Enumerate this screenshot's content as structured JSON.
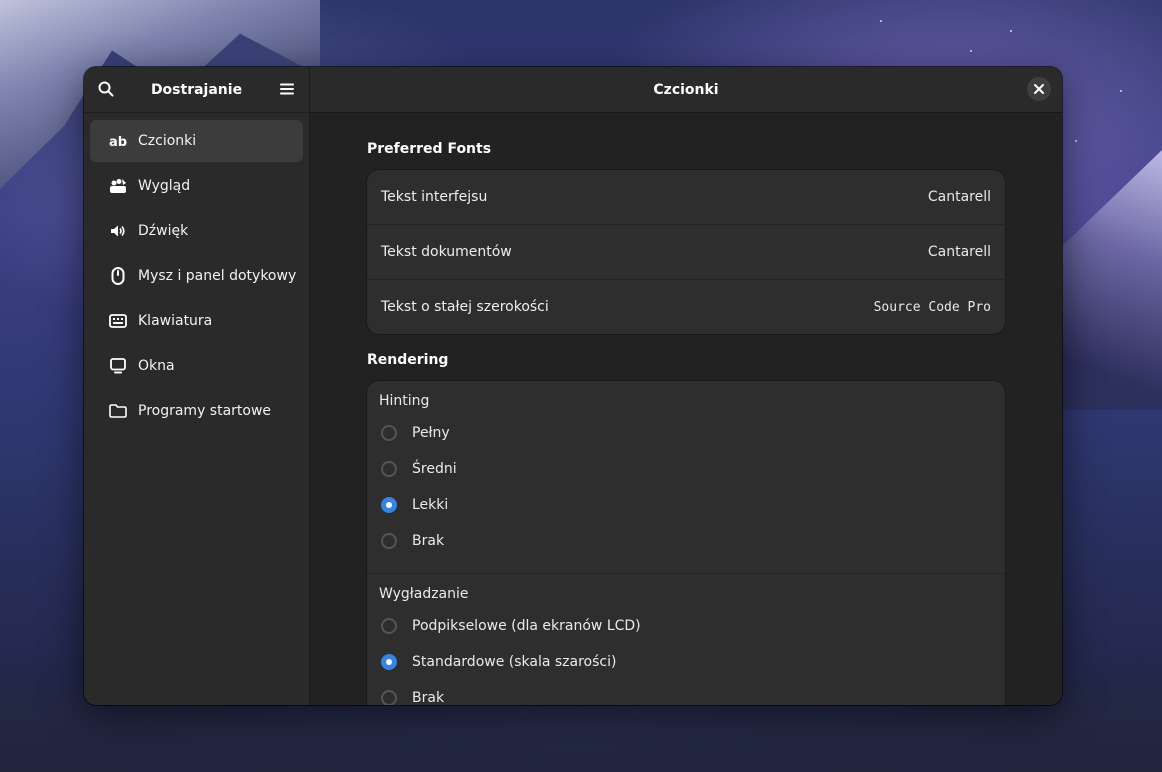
{
  "sidebar": {
    "title": "Dostrajanie",
    "search_icon": "search-icon",
    "menu_icon": "hamburger-menu-icon",
    "items": [
      {
        "label": "Czcionki",
        "icon": "fonts-ab-icon",
        "active": true
      },
      {
        "label": "Wygląd",
        "icon": "appearance-icon",
        "active": false
      },
      {
        "label": "Dźwięk",
        "icon": "speaker-icon",
        "active": false
      },
      {
        "label": "Mysz i panel dotykowy",
        "icon": "mouse-icon",
        "active": false
      },
      {
        "label": "Klawiatura",
        "icon": "keyboard-icon",
        "active": false
      },
      {
        "label": "Okna",
        "icon": "monitor-icon",
        "active": false
      },
      {
        "label": "Programy startowe",
        "icon": "folder-icon",
        "active": false
      }
    ]
  },
  "main": {
    "title": "Czcionki",
    "preferred_fonts": {
      "title": "Preferred Fonts",
      "rows": [
        {
          "label": "Tekst interfejsu",
          "value": "Cantarell"
        },
        {
          "label": "Tekst dokumentów",
          "value": "Cantarell"
        },
        {
          "label": "Tekst o stałej szerokości",
          "value": "Source Code Pro"
        }
      ]
    },
    "rendering": {
      "title": "Rendering",
      "hinting": {
        "title": "Hinting",
        "options": [
          "Pełny",
          "Średni",
          "Lekki",
          "Brak"
        ],
        "selected": "Lekki"
      },
      "antialiasing": {
        "title": "Wygładzanie",
        "options": [
          "Podpikselowe (dla ekranów LCD)",
          "Standardowe (skala szarości)",
          "Brak"
        ],
        "selected": "Standardowe (skala szarości)"
      }
    }
  },
  "colors": {
    "accent": "#3584e4",
    "window_bg": "#222222",
    "sidebar_bg": "#2a2a2a",
    "card_bg": "#2e2e2e"
  }
}
